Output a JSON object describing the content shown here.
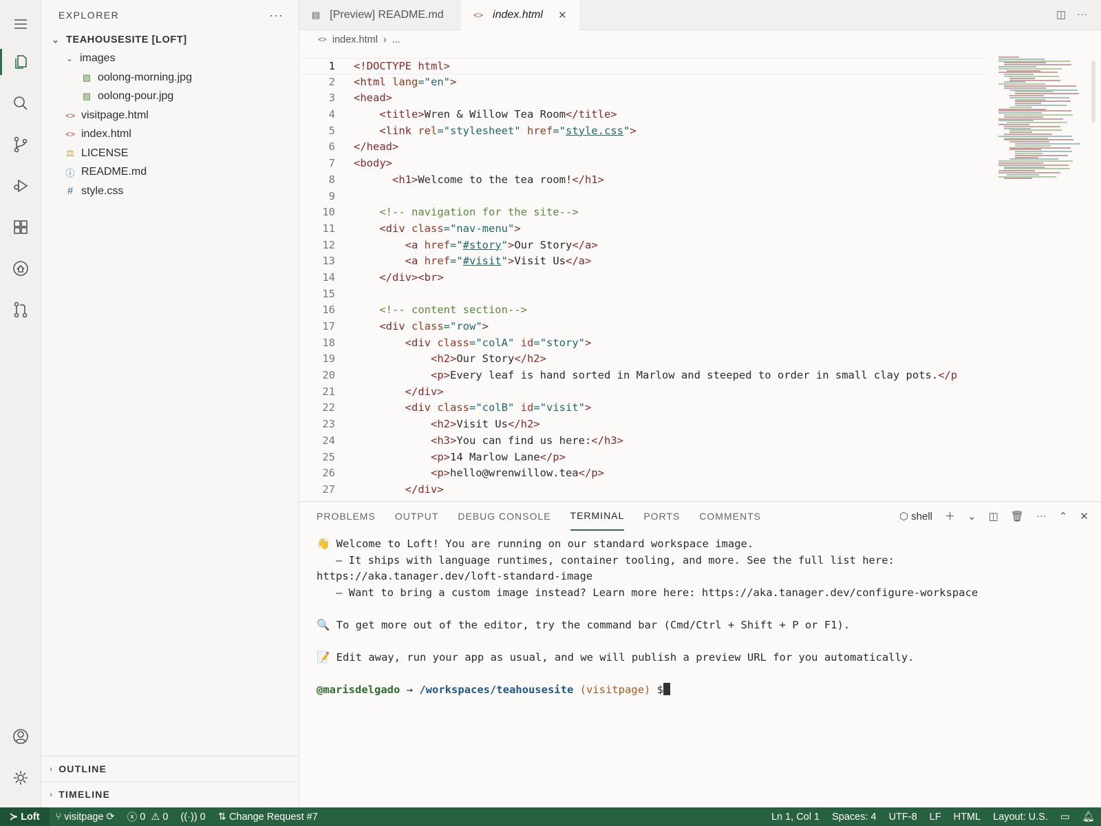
{
  "sidebar": {
    "title": "EXPLORER",
    "root": "TEAHOUSESITE [LOFT]",
    "folder": "images",
    "files_in_folder": [
      "oolong-morning.jpg",
      "oolong-pour.jpg"
    ],
    "files": [
      "visitpage.html",
      "index.html",
      "LICENSE",
      "README.md",
      "style.css"
    ],
    "outline": "OUTLINE",
    "timeline": "TIMELINE"
  },
  "tabs": [
    {
      "label": "[Preview] README.md",
      "icon": "preview-icon"
    },
    {
      "label": "index.html",
      "icon": "html-icon",
      "active": true
    }
  ],
  "breadcrumb": {
    "file": "index.html",
    "rest": "..."
  },
  "editor": {
    "line_numbers": [
      "1",
      "2",
      "3",
      "4",
      "5",
      "6",
      "7",
      "8",
      "9",
      "10",
      "11",
      "12",
      "13",
      "14",
      "15",
      "16",
      "17",
      "18",
      "19",
      "20",
      "21",
      "22",
      "23",
      "24",
      "25",
      "26",
      "27"
    ]
  },
  "code_text": {
    "l1": "<!DOCTYPE html>",
    "l2a": "<html ",
    "l2b": "lang",
    "l2c": "=\"en\"",
    "l2d": ">",
    "l3": "<head>",
    "l4a": "    <title>",
    "l4b": "Wren & Willow Tea Room",
    "l4c": "</title>",
    "l5a": "    <link ",
    "l5b": "rel",
    "l5c": "=\"stylesheet\" ",
    "l5d": "href",
    "l5e": "=\"",
    "l5f": "style.css",
    "l5g": "\"",
    "l5h": ">",
    "l6": "</head>",
    "l7": "<body>",
    "l8a": "      <h1>",
    "l8b": "Welcome to the tea room!",
    "l8c": "</h1>",
    "l10": "    <!-- navigation for the site-->",
    "l11a": "    <div ",
    "l11b": "class",
    "l11c": "=\"nav-menu\"",
    "l11d": ">",
    "l12a": "        <a ",
    "l12b": "href",
    "l12c": "=\"",
    "l12d": "#story",
    "l12e": "\"",
    "l12f": ">",
    "l12g": "Our Story",
    "l12h": "</a>",
    "l13a": "        <a ",
    "l13b": "href",
    "l13c": "=\"",
    "l13d": "#visit",
    "l13e": "\"",
    "l13f": ">",
    "l13g": "Visit Us",
    "l13h": "</a>",
    "l14": "    </div><br>",
    "l16": "    <!-- content section-->",
    "l17a": "    <div ",
    "l17b": "class",
    "l17c": "=\"row\"",
    "l17d": ">",
    "l18a": "        <div ",
    "l18b": "class",
    "l18c": "=\"colA\" ",
    "l18d": "id",
    "l18e": "=\"story\"",
    "l18f": ">",
    "l19a": "            <h2>",
    "l19b": "Our Story",
    "l19c": "</h2>",
    "l20a": "            <p>",
    "l20b": "Every leaf is hand sorted in Marlow and steeped to order in small clay pots.",
    "l20c": "</p",
    "l21": "        </div>",
    "l22a": "        <div ",
    "l22b": "class",
    "l22c": "=\"colB\" ",
    "l22d": "id",
    "l22e": "=\"visit\"",
    "l22f": ">",
    "l23a": "            <h2>",
    "l23b": "Visit Us",
    "l23c": "</h2>",
    "l24a": "            <h3>",
    "l24b": "You can find us here:",
    "l24c": "</h3>",
    "l25a": "            <p>",
    "l25b": "14 Marlow Lane",
    "l25c": "</p>",
    "l26a": "            <p>",
    "l26b": "hello@wrenwillow.tea",
    "l26c": "</p>",
    "l27": "        </div>"
  },
  "panel": {
    "tabs": [
      "PROBLEMS",
      "OUTPUT",
      "DEBUG CONSOLE",
      "TERMINAL",
      "PORTS",
      "COMMENTS"
    ],
    "active_tab": "TERMINAL",
    "shell_label": "shell"
  },
  "terminal": {
    "line1": "👋 Welcome to Loft! You are running on our standard workspace image.",
    "line2": "   — It ships with language runtimes, container tooling, and more. See the full list here:",
    "line3": "https://aka.tanager.dev/loft-standard-image",
    "line4": "   — Want to bring a custom image instead? Learn more here: https://aka.tanager.dev/configure-workspace",
    "line5": "🔍 To get more out of the editor, try the command bar (Cmd/Ctrl + Shift + P or F1).",
    "line6": "📝 Edit away, run your app as usual, and we will publish a preview URL for you automatically.",
    "prompt_user": "@marisdelgado",
    "prompt_arrow": " → ",
    "prompt_path": "/workspaces/teahousesite",
    "prompt_branch": " (visitpage)",
    "prompt_symbol": " $"
  },
  "status": {
    "remote": "Loft",
    "branch": "visitpage",
    "errors": "0",
    "warnings": "0",
    "ports": "0",
    "change_request": "Change Request #7",
    "position": "Ln 1, Col 1",
    "spaces": "Spaces: 4",
    "encoding": "UTF-8",
    "eol": "LF",
    "language": "HTML",
    "layout": "Layout: U.S."
  },
  "colors": {
    "accent": "#2f6e4f",
    "status_bar": "#26623f",
    "tag": "#8a2a2a",
    "attribute": "#9b3b1e",
    "string": "#1d6a6a",
    "comment": "#5a8a3a"
  }
}
